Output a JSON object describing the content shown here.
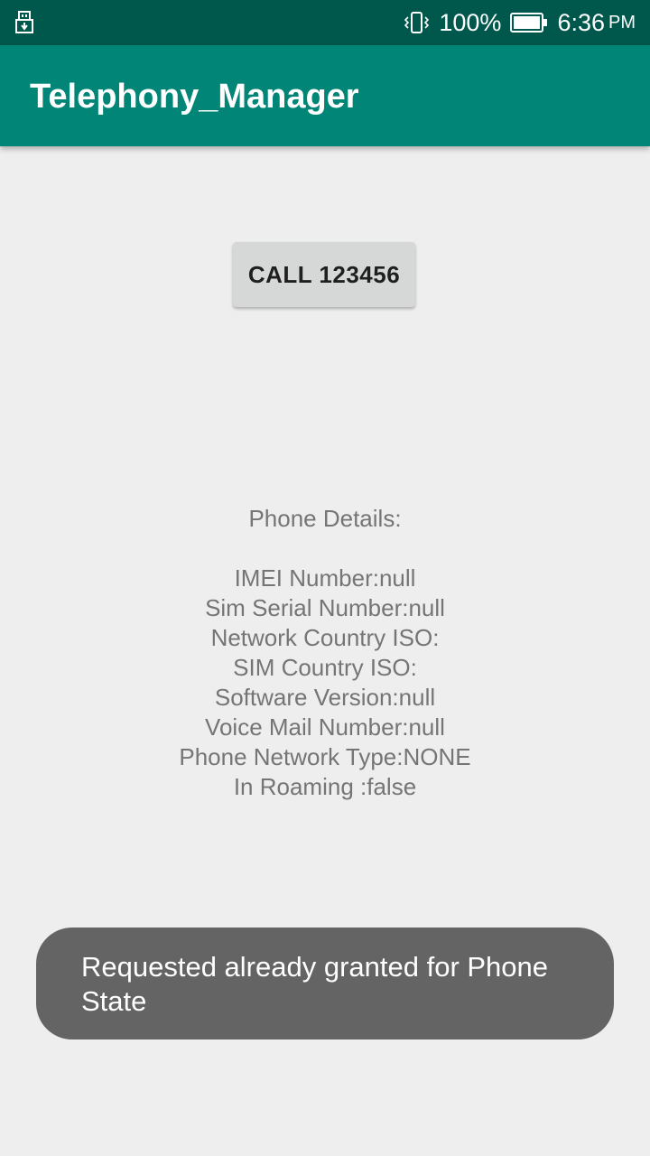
{
  "status_bar": {
    "battery_percent": "100%",
    "time": "6:36",
    "ampm": "PM",
    "icons": [
      "usb-icon",
      "vibrate-icon",
      "battery-icon"
    ]
  },
  "app_bar": {
    "title": "Telephony_Manager",
    "color": "#008577"
  },
  "call_button": {
    "label": "CALL 123456"
  },
  "phone_details": {
    "heading": "Phone Details:",
    "lines": [
      "IMEI Number:null",
      "Sim Serial Number:null",
      "Network Country ISO:",
      "SIM Country ISO:",
      "Software Version:null",
      "Voice Mail Number:null",
      "Phone Network Type:NONE",
      "In Roaming :false"
    ]
  },
  "toast": {
    "message": "Requested already granted for Phone State"
  },
  "colors": {
    "status_bar": "#00574b",
    "app_bar": "#008577",
    "background": "#eeeeee",
    "button": "#d6d7d7",
    "toast": "#646464",
    "detail_text": "#757575"
  }
}
